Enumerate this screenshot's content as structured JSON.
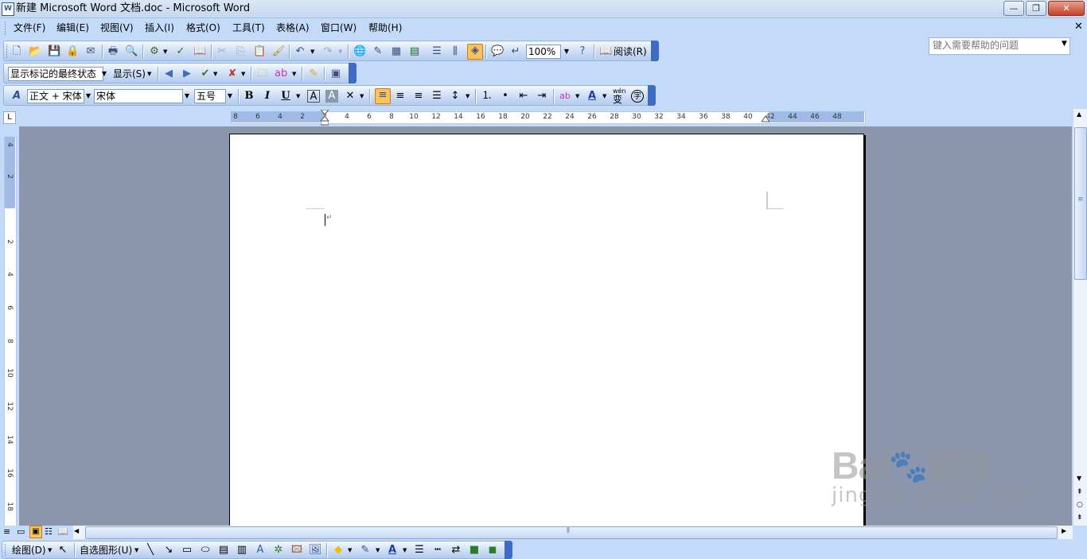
{
  "window": {
    "title": "新建 Microsoft Word 文档.doc - Microsoft Word",
    "app_icon": "W",
    "controls": [
      "minimize-icon",
      "restore-icon",
      "close-icon"
    ]
  },
  "menubar": {
    "items": [
      "文件(F)",
      "编辑(E)",
      "视图(V)",
      "插入(I)",
      "格式(O)",
      "工具(T)",
      "表格(A)",
      "窗口(W)",
      "帮助(H)"
    ],
    "help_placeholder": "键入需要帮助的问题"
  },
  "standard_toolbar": {
    "zoom": "100%",
    "read_label": "阅读(R)",
    "icons": [
      "new-icon",
      "open-icon",
      "save-icon",
      "permission-icon",
      "email-icon",
      "print-icon",
      "print-preview-icon",
      "research-icon",
      "spelling-icon",
      "cut-icon",
      "copy-icon",
      "paste-icon",
      "format-painter-icon",
      "undo-icon",
      "redo-icon",
      "hyperlink-icon",
      "tables-borders-icon",
      "insert-table-icon",
      "insert-excel-icon",
      "columns-icon",
      "drawing-icon",
      "document-map-icon",
      "show-hide-icon",
      "help-icon"
    ]
  },
  "reviewing_toolbar": {
    "display_for_review": "显示标记的最终状态",
    "show_label": "显示(S)"
  },
  "formatting_toolbar": {
    "style": "正文 + 宋体",
    "font": "宋体",
    "size": "五号",
    "bold": "B",
    "italic": "I",
    "underline": "U",
    "font_color_glyph": "A",
    "phonetic_glyph": "wén",
    "phonetic_char": "变",
    "enclose_char": "字"
  },
  "ruler": {
    "horizontal_ticks": [
      "8",
      "6",
      "4",
      "2",
      "2",
      "4",
      "6",
      "8",
      "10",
      "12",
      "14",
      "16",
      "18",
      "20",
      "22",
      "24",
      "26",
      "28",
      "30",
      "32",
      "34",
      "36",
      "38",
      "40",
      "42",
      "44",
      "46",
      "48"
    ],
    "vertical_ticks": [
      "4",
      "2",
      "2",
      "4",
      "6",
      "8",
      "10",
      "12",
      "14",
      "16",
      "18"
    ]
  },
  "drawing_toolbar": {
    "draw_label": "绘图(D)",
    "autoshapes_label": "自选图形(U)"
  },
  "watermark": {
    "brand": "Bai",
    "brand_cn": "经验",
    "url": "jingyan.baidu.com"
  }
}
